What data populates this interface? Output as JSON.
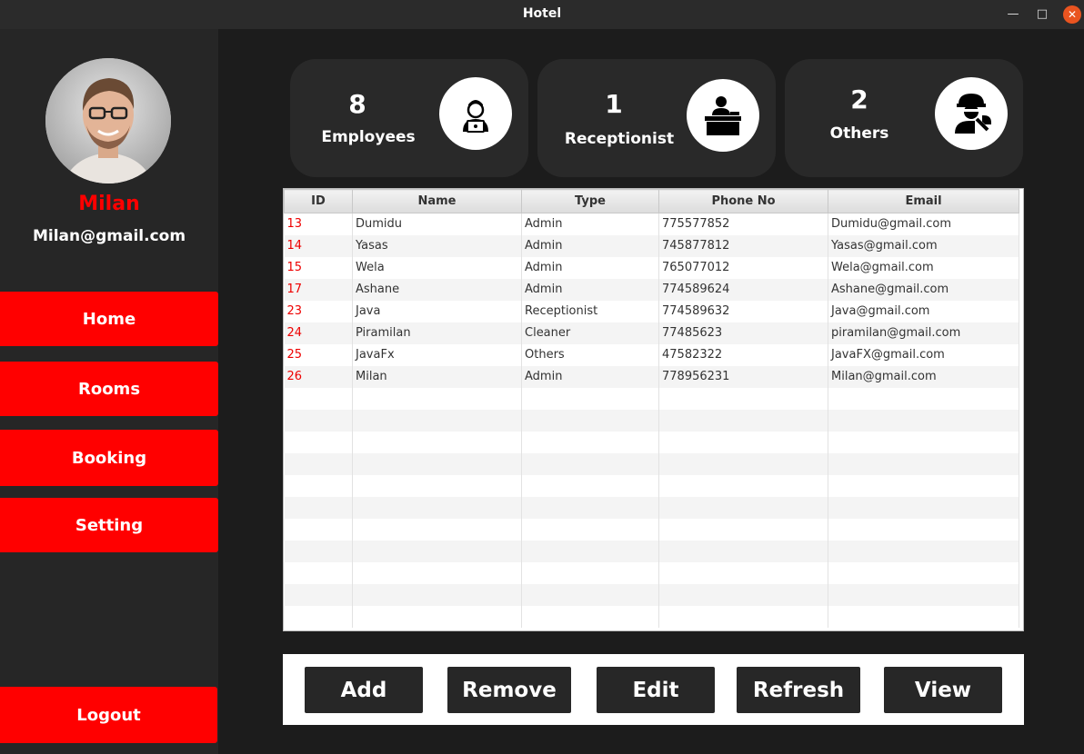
{
  "window": {
    "title": "Hotel"
  },
  "user": {
    "name": "Milan",
    "email": "Milan@gmail.com"
  },
  "nav": {
    "home": "Home",
    "rooms": "Rooms",
    "booking": "Booking",
    "setting": "Setting",
    "logout": "Logout"
  },
  "stats": [
    {
      "count": "8",
      "label": "Employees",
      "icon": "employee-laptop-icon"
    },
    {
      "count": "1",
      "label": "Receptionist",
      "icon": "receptionist-desk-icon"
    },
    {
      "count": "2",
      "label": "Others",
      "icon": "worker-wrench-icon"
    }
  ],
  "table": {
    "columns": [
      "ID",
      "Name",
      "Type",
      "Phone No",
      "Email"
    ],
    "rows": [
      [
        "13",
        "Dumidu",
        "Admin",
        "775577852",
        "Dumidu@gmail.com"
      ],
      [
        "14",
        "Yasas",
        "Admin",
        "745877812",
        "Yasas@gmail.com"
      ],
      [
        "15",
        "Wela",
        "Admin",
        "765077012",
        "Wela@gmail.com"
      ],
      [
        "17",
        "Ashane",
        "Admin",
        "774589624",
        "Ashane@gmail.com"
      ],
      [
        "23",
        "Java",
        "Receptionist",
        "774589632",
        "Java@gmail.com"
      ],
      [
        "24",
        "Piramilan",
        "Cleaner",
        "77485623",
        "piramilan@gmail.com"
      ],
      [
        "25",
        "JavaFx",
        "Others",
        "47582322",
        "JavaFX@gmail.com"
      ],
      [
        "26",
        "Milan",
        "Admin",
        "778956231",
        "Milan@gmail.com"
      ]
    ]
  },
  "actions": {
    "add": "Add",
    "remove": "Remove",
    "edit": "Edit",
    "refresh": "Refresh",
    "view": "View"
  },
  "colors": {
    "accent": "#ff0000",
    "sidebar": "#262626",
    "background": "#1c1c1c",
    "card": "#292929",
    "button": "#272727"
  }
}
